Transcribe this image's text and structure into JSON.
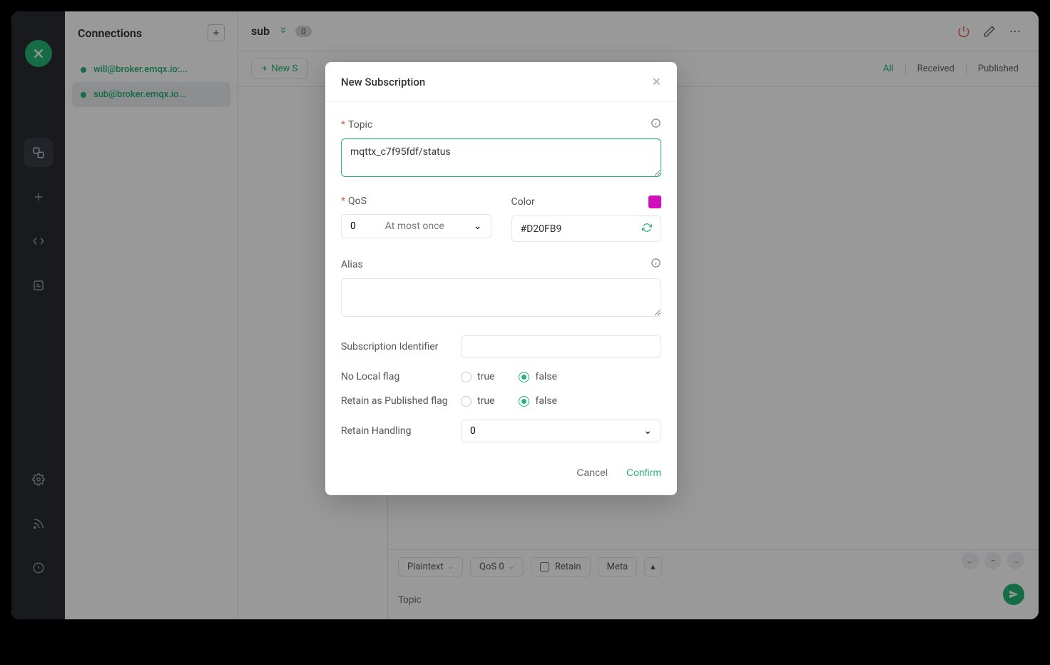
{
  "sidebar": {
    "title": "Connections",
    "items": [
      {
        "label": "will@broker.emqx.io:..."
      },
      {
        "label": "sub@broker.emqx.io..."
      }
    ]
  },
  "main": {
    "title": "sub",
    "badge": "0",
    "new_sub_label": "New S",
    "filters": {
      "all": "All",
      "received": "Received",
      "published": "Published"
    },
    "compose": {
      "format": "Plaintext",
      "qos": "QoS 0",
      "retain": "Retain",
      "meta": "Meta",
      "topic_placeholder": "Topic"
    }
  },
  "modal": {
    "title": "New Subscription",
    "topic_label": "Topic",
    "topic_value": "mqttx_c7f95fdf/status",
    "qos_label": "QoS",
    "qos_value": "0",
    "qos_text": "At most once",
    "color_label": "Color",
    "color_value": "#D20FB9",
    "alias_label": "Alias",
    "alias_value": "",
    "sub_id_label": "Subscription Identifier",
    "sub_id_value": "",
    "no_local_label": "No Local flag",
    "retain_pub_label": "Retain as Published flag",
    "retain_handling_label": "Retain Handling",
    "retain_handling_value": "0",
    "radio_true": "true",
    "radio_false": "false",
    "cancel": "Cancel",
    "confirm": "Confirm"
  }
}
